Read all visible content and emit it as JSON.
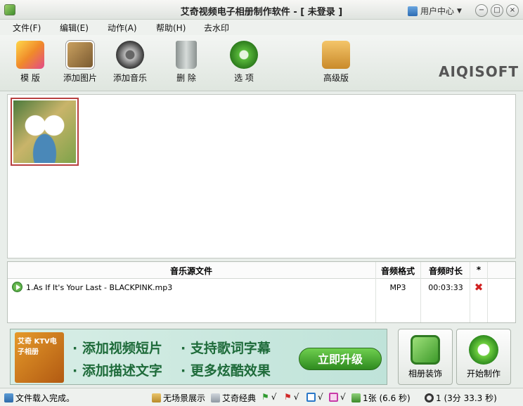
{
  "window": {
    "title": "艾奇视频电子相册制作软件 - [ 未登录 ]",
    "user_center": "用户中心",
    "minimize": "−",
    "maximize": "□",
    "close": "×"
  },
  "menu": [
    "文件(F)",
    "编辑(E)",
    "动作(A)",
    "帮助(H)",
    "去水印"
  ],
  "toolbar": [
    {
      "label": "模 版",
      "icon": "template-icon"
    },
    {
      "label": "添加图片",
      "icon": "add-picture-icon"
    },
    {
      "label": "添加音乐",
      "icon": "add-music-icon"
    },
    {
      "label": "删 除",
      "icon": "recycle-bin-icon"
    },
    {
      "label": "选 项",
      "icon": "options-gear-icon"
    },
    {
      "label": "高级版",
      "icon": "upgrade-arrow-icon"
    }
  ],
  "logo": "AIQISOFT",
  "music_table": {
    "headers": [
      "音乐源文件",
      "音频格式",
      "音频时长",
      "*"
    ],
    "rows": [
      {
        "file": "1.As If It's Your Last - BLACKPINK.mp3",
        "format": "MP3",
        "duration": "00:03:33"
      }
    ]
  },
  "banner": {
    "ktv_title": "艾奇 KTV电子相册",
    "line1_a": "· 添加视频短片",
    "line1_b": "· 支持歌词字幕",
    "line2_a": "· 添加描述文字",
    "line2_b": "· 更多炫酷效果",
    "upgrade_button": "立即升级"
  },
  "actions": {
    "decorate": "相册装饰",
    "start": "开始制作"
  },
  "status": {
    "message": "文件载入完成。",
    "scene": "无场景展示",
    "theme": "艾奇经典",
    "check1": "√",
    "check2": "√",
    "check3": "√",
    "check4": "√",
    "photos": "1张 (6.6 秒)",
    "music": "1 (3分 33.3 秒)"
  }
}
